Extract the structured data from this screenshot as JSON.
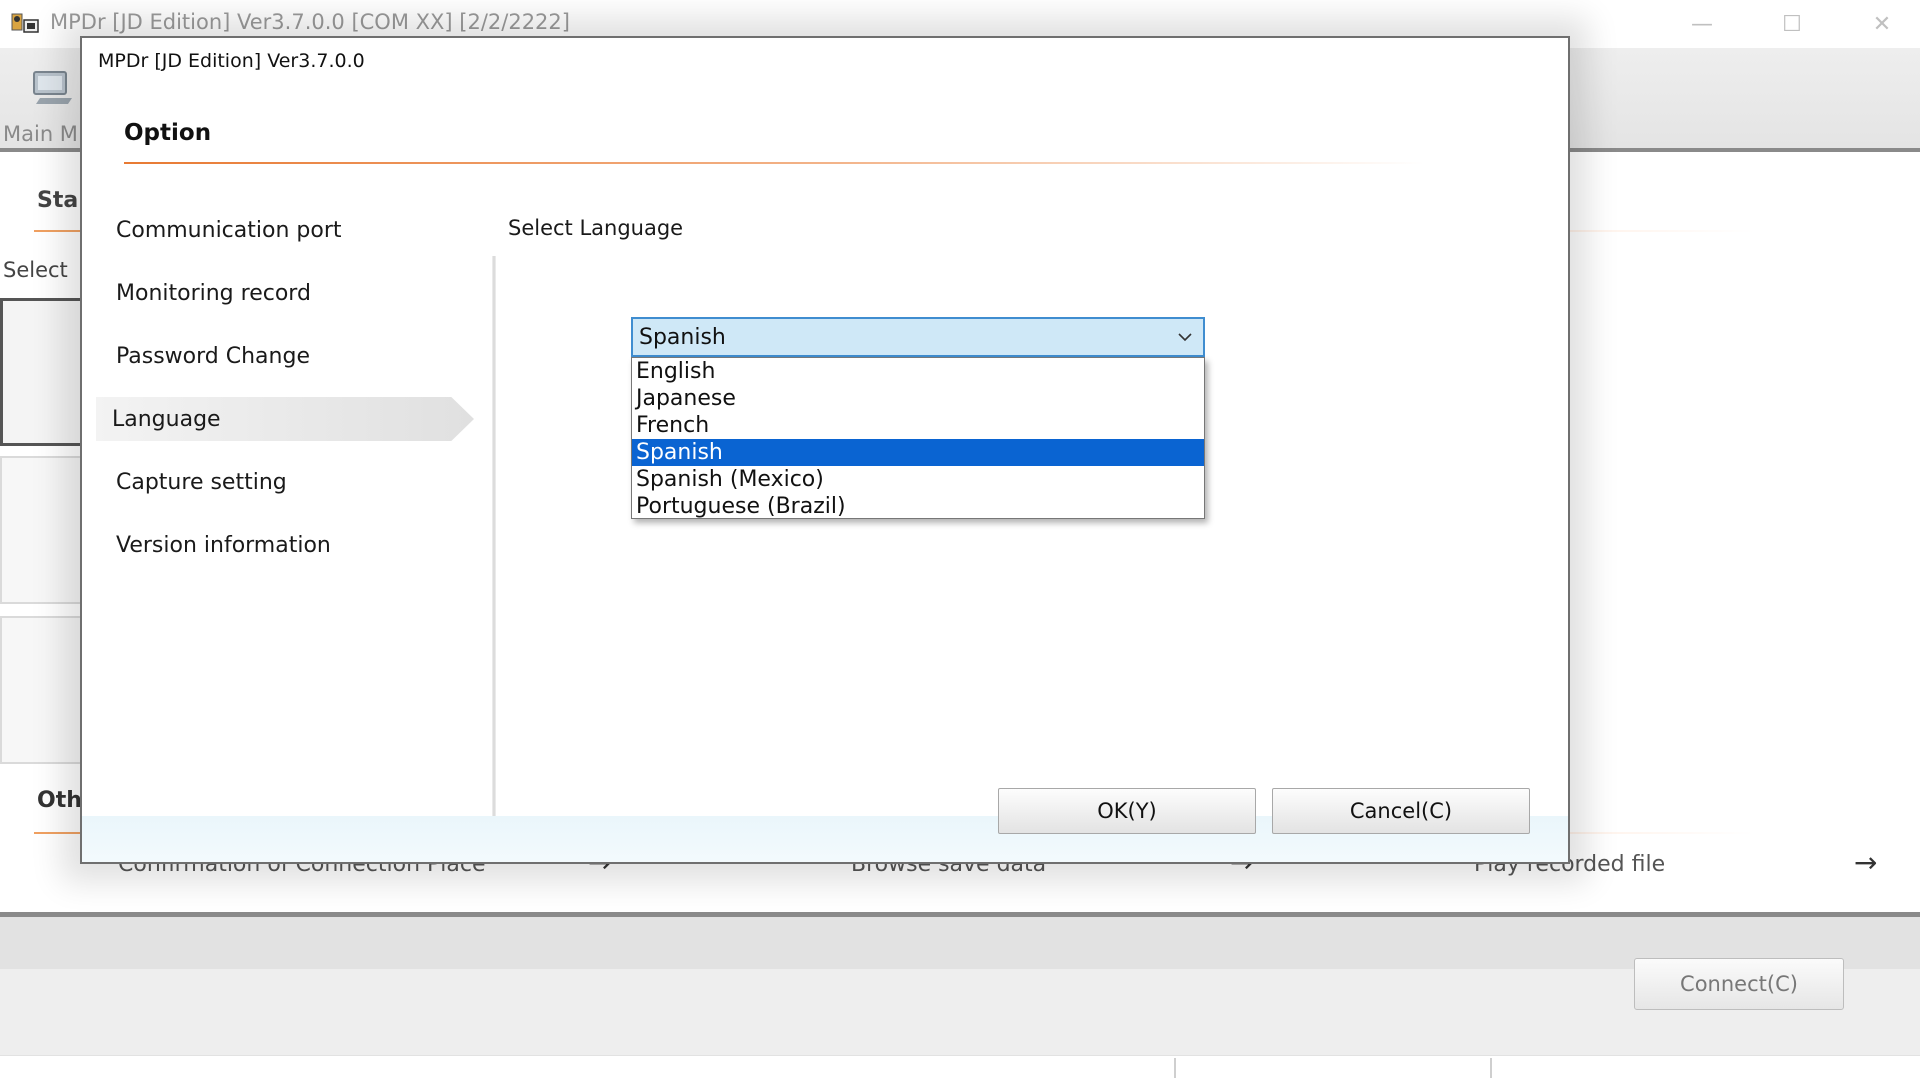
{
  "background_window": {
    "title": "MPDr [JD Edition] Ver3.7.0.0 [COM XX] [2/2/2222]",
    "controls": {
      "minimize": "—",
      "maximize": "☐",
      "close": "✕"
    },
    "ribbon_label": "Main M",
    "start_heading": "Star",
    "select_text": "Select",
    "other_heading": "Oth",
    "links": [
      {
        "label": "Confirmation of Connection Place",
        "arrow": "→"
      },
      {
        "label": "Browse save data",
        "arrow": "→"
      },
      {
        "label": "Play recorded file",
        "arrow": "→"
      }
    ],
    "connect_button": "Connect(C)"
  },
  "dialog": {
    "title": "MPDr [JD Edition] Ver3.7.0.0",
    "header": "Option",
    "menu": [
      {
        "label": "Communication port",
        "selected": false
      },
      {
        "label": "Monitoring record",
        "selected": false
      },
      {
        "label": "Password Change",
        "selected": false
      },
      {
        "label": "Language",
        "selected": true
      },
      {
        "label": "Capture setting",
        "selected": false
      },
      {
        "label": "Version information",
        "selected": false
      }
    ],
    "language_label": "Select Language",
    "combo_value": "Spanish",
    "options": [
      {
        "label": "English",
        "selected": false
      },
      {
        "label": "Japanese",
        "selected": false
      },
      {
        "label": "French",
        "selected": false
      },
      {
        "label": "Spanish",
        "selected": true
      },
      {
        "label": "Spanish (Mexico)",
        "selected": false
      },
      {
        "label": "Portuguese (Brazil)",
        "selected": false
      }
    ],
    "ok_button": "OK(Y)",
    "cancel_button": "Cancel(C)"
  },
  "colors": {
    "accent_line": "#e87a33",
    "selection_blue": "#0a64d2",
    "combo_fill": "#cfe8f7",
    "combo_border": "#3f8dd0"
  },
  "icons": [
    "app-icon",
    "computer-icon",
    "chevron-down-icon",
    "arrow-right-icon"
  ]
}
